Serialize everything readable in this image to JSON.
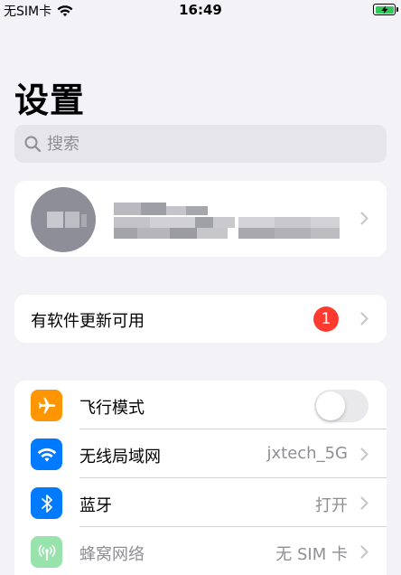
{
  "status_bar": {
    "carrier": "无SIM卡",
    "time": "16:49",
    "wifi_icon": "wifi-icon",
    "battery_icon": "battery-charging-icon"
  },
  "title": "设置",
  "search": {
    "placeholder": "搜索",
    "value": ""
  },
  "profile": {
    "avatar_icon": "avatar-icon",
    "name_text": ""
  },
  "update": {
    "label": "有软件更新可用",
    "badge": "1"
  },
  "rows": [
    {
      "label": "飞行模式",
      "icon": "airplane-icon",
      "icon_color": "#ff9500",
      "toggle_on": false
    },
    {
      "label": "无线局域网",
      "icon": "wifi-icon",
      "icon_color": "#007aff",
      "value": "jxtech_5G"
    },
    {
      "label": "蓝牙",
      "icon": "bluetooth-icon",
      "icon_color": "#007aff",
      "value": "打开"
    },
    {
      "label": "蜂窝网络",
      "icon": "cellular-icon",
      "icon_color": "#34c759",
      "value": "无 SIM 卡"
    }
  ],
  "colors": {
    "background": "#f2f2f7",
    "badge": "#ff3b30",
    "chevron": "#c7c7cc",
    "secondary_text": "#8e8e93"
  }
}
